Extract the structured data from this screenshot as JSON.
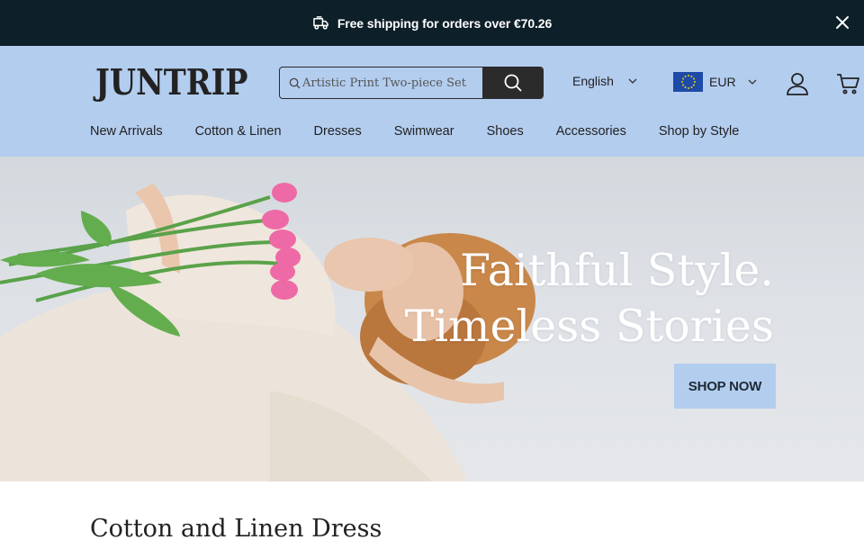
{
  "announcement": {
    "text": "Free shipping for orders over €70.26",
    "icon": "truck-icon"
  },
  "header": {
    "logo": "JUNTRIP",
    "search": {
      "placeholder": "Artistic Print Two-piece Set",
      "value": ""
    },
    "language": "English",
    "currency": "EUR",
    "icons": [
      "search-icon",
      "eu-flag-icon",
      "chevron-down-icon",
      "account-icon",
      "cart-icon"
    ]
  },
  "nav": {
    "items": [
      {
        "label": "New Arrivals"
      },
      {
        "label": "Cotton & Linen"
      },
      {
        "label": "Dresses"
      },
      {
        "label": "Swimwear"
      },
      {
        "label": "Shoes"
      },
      {
        "label": "Accessories"
      },
      {
        "label": "Shop by Style"
      }
    ]
  },
  "hero": {
    "line1": "Faithful Style.",
    "line2": "Timeless Stories",
    "cta": "SHOP NOW"
  },
  "section": {
    "title": "Cotton and Linen Dress"
  },
  "colors": {
    "announcement_bg": "#0d1f28",
    "header_bg": "#b3cdef",
    "button_dark": "#2b2b2b",
    "cta_bg": "#b3cdef"
  }
}
